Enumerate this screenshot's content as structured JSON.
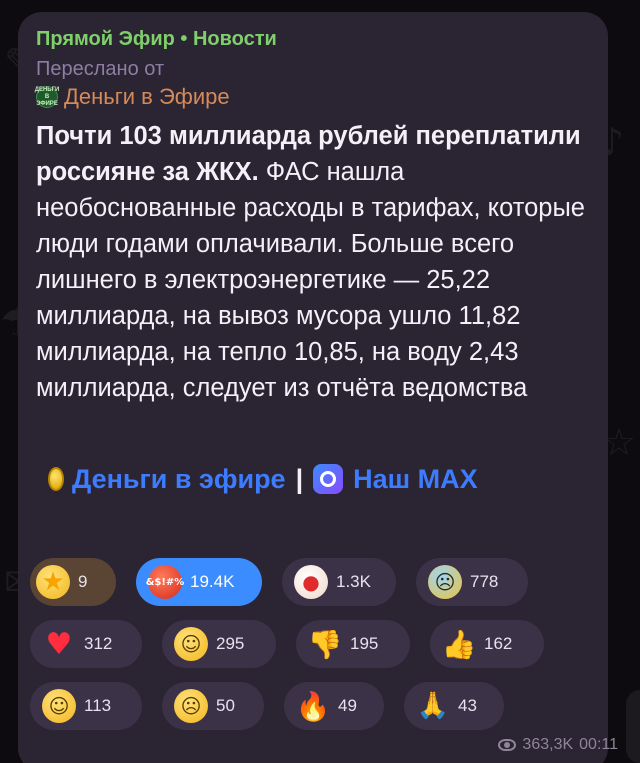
{
  "message": {
    "header": "Прямой Эфир • Новости",
    "forwarded_label": "Переслано от",
    "source": {
      "name": "Деньги в Эфире",
      "avatar_text": "ДЕНЬГИ В ЭФИРЕ"
    },
    "text_bold": "Почти 103 миллиарда рублей переплатили россияне за ЖКХ.",
    "text_body": " ФАС нашла необоснованные расходы в тарифах, которые люди годами оплачивали. Больше всего лишнего в электроэнергетике — 25,22 миллиарда, на вывоз мусора ушло 11,82 миллиарда, на тепло 10,85, на воду 2,43 миллиарда, следует из отчёта ведомства",
    "links": {
      "channel_link": "Деньги в эфире",
      "separator": "|",
      "max_link": "Наш MAX"
    }
  },
  "reactions": {
    "row1": [
      {
        "icon": "star-icon",
        "glyph": "★",
        "count": "9"
      },
      {
        "icon": "angry-face-icon",
        "glyph": "&$!#%",
        "count": "19.4K"
      },
      {
        "icon": "clown-face-icon",
        "glyph": "●",
        "count": "1.3K"
      },
      {
        "icon": "screaming-face-icon",
        "glyph": "☹",
        "count": "778"
      }
    ],
    "row2": [
      {
        "icon": "heart-icon",
        "glyph": "♥",
        "count": "312"
      },
      {
        "icon": "grinning-face-icon",
        "glyph": "☺",
        "count": "295"
      },
      {
        "icon": "thumbs-down-icon",
        "glyph": "👎",
        "count": "195"
      },
      {
        "icon": "thumbs-up-icon",
        "glyph": "👍",
        "count": "162"
      }
    ],
    "row3": [
      {
        "icon": "thinking-face-icon",
        "glyph": "☺",
        "count": "113"
      },
      {
        "icon": "crying-face-icon",
        "glyph": "☹",
        "count": "50"
      },
      {
        "icon": "fire-icon",
        "glyph": "🔥",
        "count": "49"
      },
      {
        "icon": "praying-hands-icon",
        "glyph": "🙏",
        "count": "43"
      }
    ]
  },
  "footer": {
    "views": "363,3K",
    "time": "00:11"
  },
  "colors": {
    "header_green": "#7fcf6a",
    "source_orange": "#d58a58",
    "link_blue": "#3d7cff",
    "active_reaction": "#3b8cff",
    "bubble": "#2b2433"
  }
}
